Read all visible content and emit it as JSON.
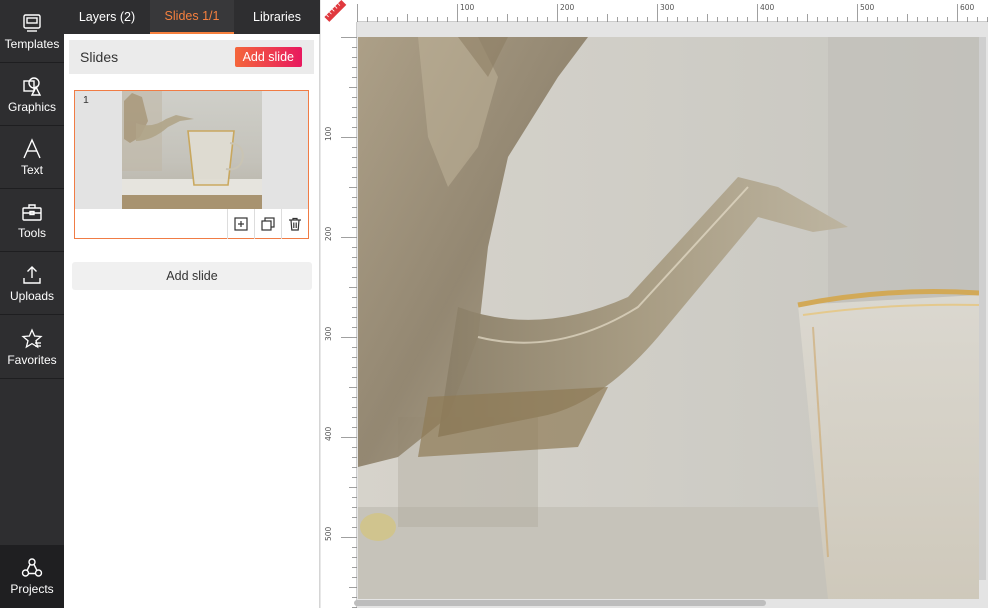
{
  "rail": {
    "items": [
      {
        "label": "Templates",
        "icon": "templates-icon"
      },
      {
        "label": "Graphics",
        "icon": "graphics-icon"
      },
      {
        "label": "Text",
        "icon": "text-icon"
      },
      {
        "label": "Tools",
        "icon": "tools-icon"
      },
      {
        "label": "Uploads",
        "icon": "upload-icon"
      },
      {
        "label": "Favorites",
        "icon": "favorites-icon"
      }
    ],
    "projects": {
      "label": "Projects",
      "icon": "projects-icon"
    }
  },
  "tabs": {
    "layers": "Layers (2)",
    "slides": "Slides 1/1",
    "libraries": "Libraries"
  },
  "slides_panel": {
    "title": "Slides",
    "add_button": "Add slide",
    "slide_number": "1",
    "add_button_bottom": "Add slide"
  },
  "rulers": {
    "top_labels": [
      "100",
      "200",
      "300",
      "400",
      "500",
      "600"
    ],
    "left_labels": [
      "100",
      "200",
      "300",
      "400",
      "500"
    ]
  },
  "colors": {
    "accent": "#f6803e",
    "rail_bg": "#2e2e30",
    "add_gradient_start": "#f4663b",
    "add_gradient_end": "#e8195f"
  }
}
